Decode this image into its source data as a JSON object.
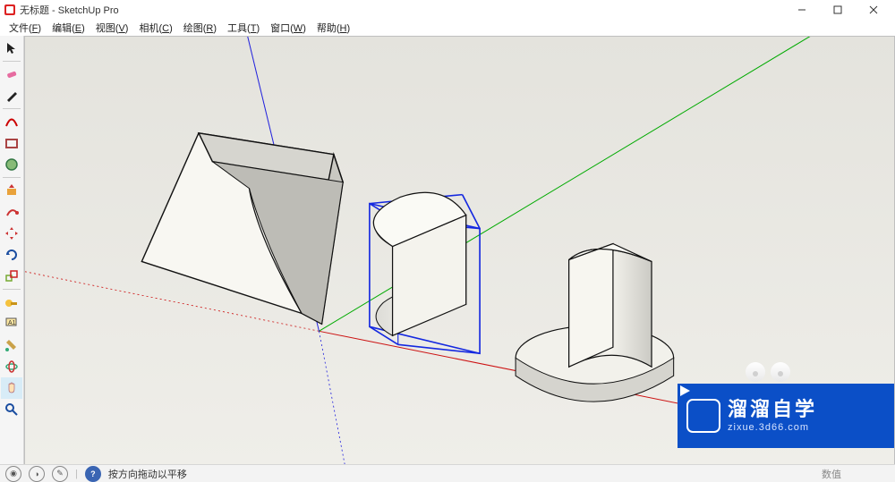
{
  "titlebar": {
    "title": "无标题 - SketchUp Pro"
  },
  "menubar": {
    "items": [
      {
        "label": "文件",
        "key": "F"
      },
      {
        "label": "编辑",
        "key": "E"
      },
      {
        "label": "视图",
        "key": "V"
      },
      {
        "label": "相机",
        "key": "C"
      },
      {
        "label": "绘图",
        "key": "R"
      },
      {
        "label": "工具",
        "key": "T"
      },
      {
        "label": "窗口",
        "key": "W"
      },
      {
        "label": "帮助",
        "key": "H"
      }
    ]
  },
  "toolbar_left": {
    "tools": [
      "select",
      "eraser",
      "pencil",
      "arc",
      "rectangle",
      "circle",
      "pushpull",
      "followme",
      "move",
      "rotate",
      "scale",
      "tape",
      "text",
      "paint",
      "orbit",
      "pan",
      "zoom"
    ]
  },
  "statusbar": {
    "hint": "按方向拖动以平移",
    "measurement_label": "数值"
  },
  "watermark": {
    "line1": "溜溜自学",
    "line2": "zixue.3d66.com"
  }
}
